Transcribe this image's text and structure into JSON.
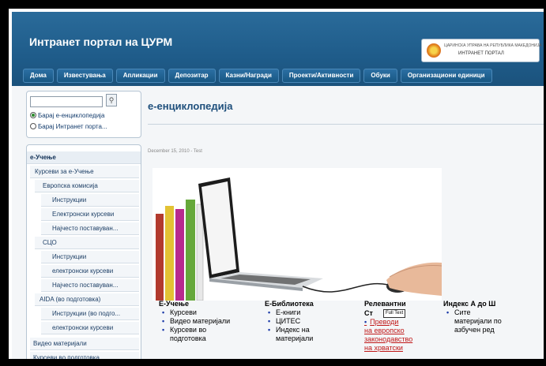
{
  "header": {
    "title": "Интранет портал на ЦУРМ",
    "logo_line1": "ЦАРИНСКА УПРАВА НА РЕПУБЛИКА МАКЕДОНИЈА",
    "logo_line2": "ИНТРАНЕТ ПОРТАЛ"
  },
  "nav": [
    {
      "label": "Дома"
    },
    {
      "label": "Известувања"
    },
    {
      "label": "Апликации"
    },
    {
      "label": "Депозитар"
    },
    {
      "label": "Казни/Награди"
    },
    {
      "label": "Проекти/Активности"
    },
    {
      "label": "Обуки"
    },
    {
      "label": "Организациони единици"
    }
  ],
  "search": {
    "input_value": "",
    "button_icon": "search-icon",
    "option1": "Барај е-енциклопедија",
    "option2": "Барај Интранет порта...",
    "selected": "option1"
  },
  "sidebar": [
    {
      "label": "е-Учење",
      "level": 0,
      "head": true
    },
    {
      "label": "Курсеви за е-Учење",
      "level": 1
    },
    {
      "label": "Европска комисија",
      "level": 2
    },
    {
      "label": "Инструкции",
      "level": 3
    },
    {
      "label": "Електронски курсеви",
      "level": 3
    },
    {
      "label": "Најчесто поставуван...",
      "level": 3
    },
    {
      "label": "СЦО",
      "level": 2
    },
    {
      "label": "Инструкции",
      "level": 3
    },
    {
      "label": "електронски курсеви",
      "level": 3
    },
    {
      "label": "Најчесто поставуван...",
      "level": 3
    },
    {
      "label": "AIDA (во подготовка)",
      "level": 2
    },
    {
      "label": "Инструкции (во подго...",
      "level": 3
    },
    {
      "label": "електронски курсеви",
      "level": 3
    },
    {
      "label": "Видео материјали",
      "level": 1
    },
    {
      "label": "Курсеви во подготовка",
      "level": 1
    }
  ],
  "main": {
    "heading": "е-енциклопедија",
    "date": "December 15, 2010 - Test",
    "columns": [
      {
        "title": "Е-Учење",
        "items": [
          "Курсеви",
          "Видео материјали",
          "Курсеви во",
          "подготовка"
        ],
        "link": false
      },
      {
        "title": "Е-Библиотека",
        "items": [
          "Е-книги",
          "ЦИТЕС",
          "Индекс на",
          "материјали"
        ],
        "link": false
      },
      {
        "title": "Релевантни",
        "title2": "Ст",
        "items": [
          "Преводи",
          "на   европско",
          "законодавство",
          "на хрватски"
        ],
        "link": true
      },
      {
        "title": "Индекс А до Ш",
        "items": [
          "Сите",
          "материјали по",
          "азбучен ред"
        ],
        "link": false
      }
    ],
    "tooltip": "Full Text"
  }
}
